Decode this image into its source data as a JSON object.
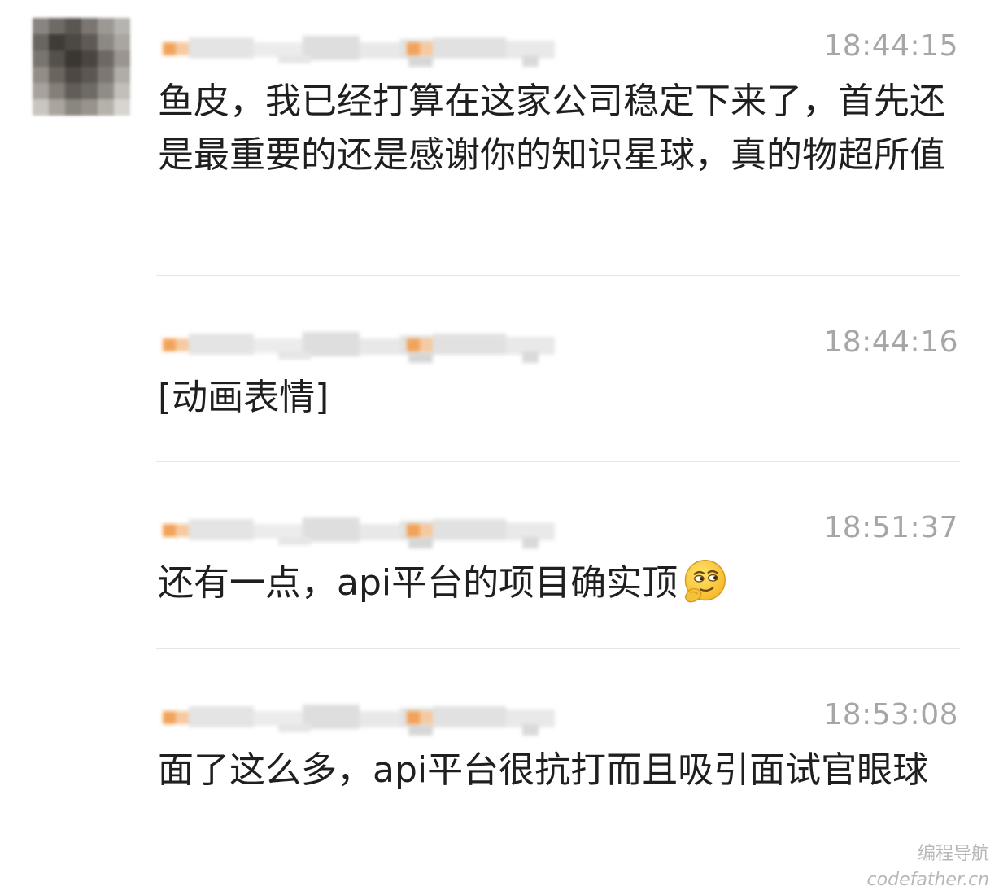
{
  "messages": [
    {
      "time": "18:44:15",
      "text": "鱼皮，我已经打算在这家公司稳定下来了，首先还是最重要的还是感谢你的知识星球，真的物超所值"
    },
    {
      "time": "18:44:16",
      "text": "[动画表情]"
    },
    {
      "time": "18:51:37",
      "text": "还有一点，api平台的项目确实顶",
      "emoji": "smirk-thinking-emoji-icon"
    },
    {
      "time": "18:53:08",
      "text": "面了这么多，api平台很抗打而且吸引面试官眼球"
    }
  ],
  "watermark": {
    "title": "编程导航",
    "domain": "codefather.cn"
  },
  "colors": {
    "timestamp": "#a6a6a6",
    "text": "#1f1f1f",
    "divider": "#e6e6e6",
    "name_accent": "#f2a35a"
  }
}
